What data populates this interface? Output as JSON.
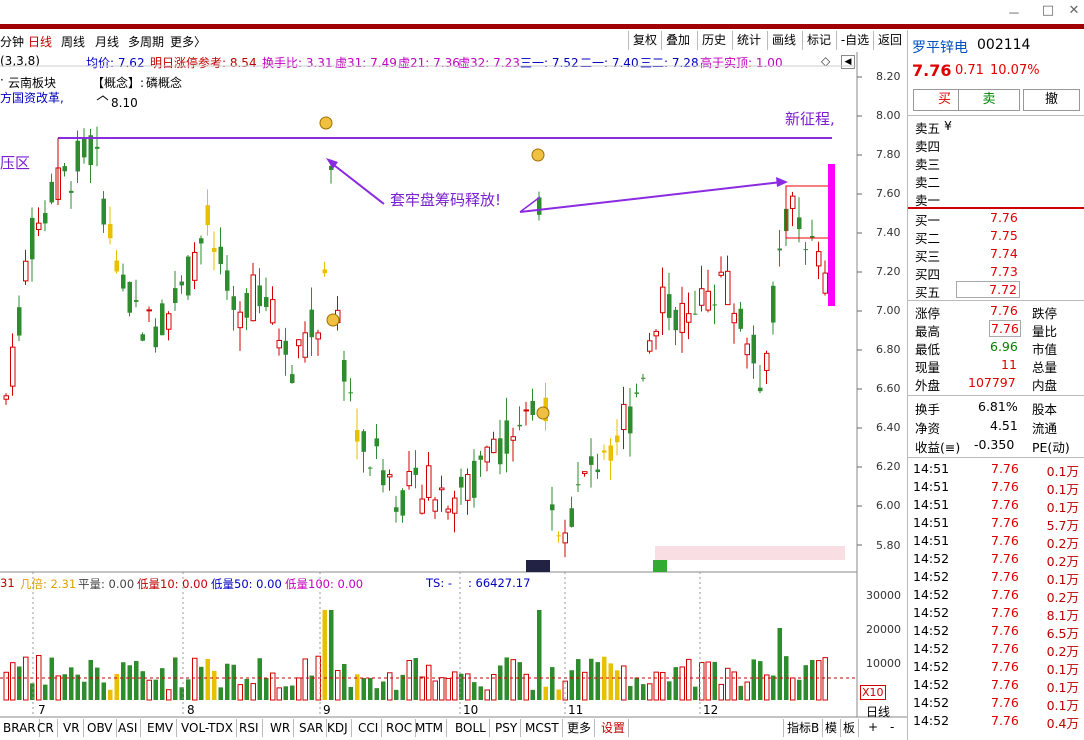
{
  "window": {
    "minimize": "－",
    "maximize": "□",
    "close": "✕"
  },
  "tabs": [
    {
      "label": "分钟",
      "active": false
    },
    {
      "label": "日线",
      "active": true
    },
    {
      "label": "周线",
      "active": false
    },
    {
      "label": "月线",
      "active": false
    },
    {
      "label": "多周期",
      "active": false
    },
    {
      "label": "更多〉",
      "active": false
    }
  ],
  "toolbar": [
    "复权",
    "叠加",
    "历史",
    "统计",
    "画线",
    "标记",
    "-自选",
    "返回"
  ],
  "infobar": {
    "params": "(3,3,8)",
    "avg": "均价: 7.62",
    "limit_ref": "明日涨停参考: 8.54",
    "turnover_ratio": "换手比: 3.31",
    "v31": "虚31: 7.49",
    "v21": "虚21: 7.36",
    "v32": "虚32: 7.23",
    "s1": "三一: 7.52",
    "e1": "二一: 7.40",
    "s2": "三二: 7.28",
    "above": "高于实顶: 1.00"
  },
  "concept": {
    "board": "云南板块",
    "reform": "方国资改革,",
    "concept_label": "【概念】:",
    "concept_val": "磷概念",
    "peak": "8.10"
  },
  "annotations": {
    "left": "压区",
    "right": "新征程,",
    "arrow_text": "套牢盘筹码释放!"
  },
  "price_axis": [
    "8.20",
    "8.00",
    "7.80",
    "7.60",
    "7.40",
    "7.20",
    "7.00",
    "6.80",
    "6.60",
    "6.40",
    "6.20",
    "6.00",
    "5.80"
  ],
  "volume_axis": [
    "30000",
    "20000",
    "10000"
  ],
  "vol_x": "X10",
  "months": [
    "7",
    "8",
    "9",
    "10",
    "11",
    "12"
  ],
  "indicator_line": {
    "a": "31",
    "jb": "几倍: 2.31",
    "pl": "平量: 0.00",
    "l10": "低量10: 0.00",
    "l50": "低量50: 0.00",
    "l100": "低量100: 0.00",
    "ts": "TS: -",
    "tsv": ": 66427.17"
  },
  "bottom_tabs": [
    "BRAR",
    "CR",
    "VR",
    "OBV",
    "ASI",
    "EMV",
    "VOL-TDX",
    "RSI",
    "WR",
    "SAR",
    "KDJ",
    "CCI",
    "ROC",
    "MTM",
    "BOLL",
    "PSY",
    "MCST",
    "更多",
    "设置"
  ],
  "bottom_right": [
    "指标B",
    "模",
    "板"
  ],
  "bottom_right2": [
    "日线",
    "+",
    "-"
  ],
  "stock": {
    "name": "罗平锌电",
    "code": "002114",
    "price": "7.76",
    "change": "0.71",
    "pct": "10.07%"
  },
  "actions": [
    "买",
    "卖",
    "撤"
  ],
  "sell_levels": [
    {
      "label": "卖五",
      "v": "¥"
    },
    {
      "label": "卖四",
      "v": ""
    },
    {
      "label": "卖三",
      "v": ""
    },
    {
      "label": "卖二",
      "v": ""
    },
    {
      "label": "卖一",
      "v": ""
    }
  ],
  "buy_levels": [
    {
      "label": "买一",
      "price": "7.76"
    },
    {
      "label": "买二",
      "price": "7.75"
    },
    {
      "label": "买三",
      "price": "7.74"
    },
    {
      "label": "买四",
      "price": "7.73"
    },
    {
      "label": "买五",
      "price": "7.72"
    }
  ],
  "stats": [
    {
      "l1": "涨停",
      "v1": "7.76",
      "l2": "跌停"
    },
    {
      "l1": "最高",
      "v1": "7.76",
      "l2": "量比"
    },
    {
      "l1": "最低",
      "v1": "6.96",
      "l2": "市值"
    },
    {
      "l1": "现量",
      "v1": "11",
      "l2": "总量"
    },
    {
      "l1": "外盘",
      "v1": "107797",
      "l2": "内盘"
    }
  ],
  "stats2": [
    {
      "l1": "换手",
      "v1": "6.81%",
      "l2": "股本"
    },
    {
      "l1": "净资",
      "v1": "4.51",
      "l2": "流通"
    },
    {
      "l1": "收益(≡)",
      "v1": "-0.350",
      "l2": "PE(动)"
    }
  ],
  "ticks": [
    {
      "t": "14:51",
      "p": "7.76",
      "v": "0.1万"
    },
    {
      "t": "14:51",
      "p": "7.76",
      "v": "0.1万"
    },
    {
      "t": "14:51",
      "p": "7.76",
      "v": "0.1万"
    },
    {
      "t": "14:51",
      "p": "7.76",
      "v": "5.7万"
    },
    {
      "t": "14:51",
      "p": "7.76",
      "v": "0.2万"
    },
    {
      "t": "14:52",
      "p": "7.76",
      "v": "0.2万"
    },
    {
      "t": "14:52",
      "p": "7.76",
      "v": "0.1万"
    },
    {
      "t": "14:52",
      "p": "7.76",
      "v": "0.2万"
    },
    {
      "t": "14:52",
      "p": "7.76",
      "v": "8.1万"
    },
    {
      "t": "14:52",
      "p": "7.76",
      "v": "6.5万"
    },
    {
      "t": "14:52",
      "p": "7.76",
      "v": "0.2万"
    },
    {
      "t": "14:52",
      "p": "7.76",
      "v": "0.1万"
    },
    {
      "t": "14:52",
      "p": "7.76",
      "v": "0.1万"
    },
    {
      "t": "14:52",
      "p": "7.76",
      "v": "0.1万"
    },
    {
      "t": "14:52",
      "p": "7.76",
      "v": "0.4万"
    }
  ]
}
